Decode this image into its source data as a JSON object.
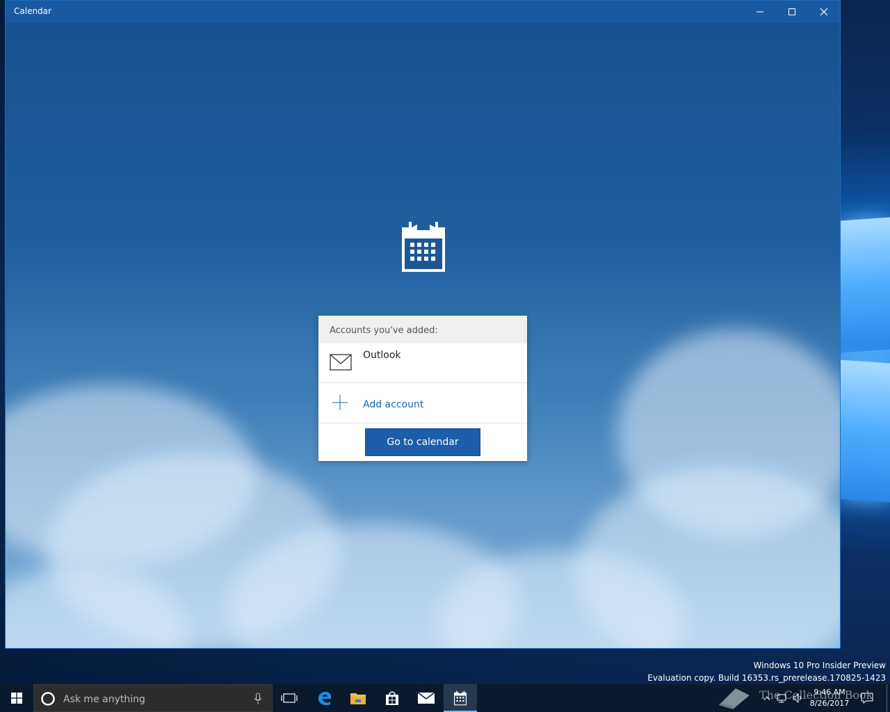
{
  "window": {
    "title": "Calendar",
    "minimize_icon": "minimize-icon",
    "maximize_icon": "maximize-icon",
    "close_icon": "close-icon"
  },
  "welcome": {
    "app_icon": "calendar-icon",
    "accounts_header": "Accounts you've added:",
    "accounts": [
      {
        "name": "Outlook",
        "icon": "mail-icon"
      }
    ],
    "add_account_label": "Add account",
    "add_account_icon": "plus-icon",
    "go_button_label": "Go to calendar"
  },
  "watermark": {
    "line1": "Windows 10 Pro Insider Preview",
    "line2": "Evaluation copy. Build 16353.rs_prerelease.170825-1423"
  },
  "taskbar": {
    "start_icon": "windows-start-icon",
    "search_placeholder": "Ask me anything",
    "cortana_icon": "cortana-circle-icon",
    "mic_icon": "microphone-icon",
    "pinned": [
      {
        "name": "Task View",
        "icon": "task-view-icon"
      },
      {
        "name": "Edge",
        "icon": "edge-icon"
      },
      {
        "name": "File Explorer",
        "icon": "folder-icon"
      },
      {
        "name": "Store",
        "icon": "store-icon"
      },
      {
        "name": "Mail",
        "icon": "mail-icon"
      },
      {
        "name": "Calendar",
        "icon": "calendar-icon",
        "active": true
      }
    ],
    "tray": {
      "overlay_text": "The Collection Book",
      "time": "9:46 AM",
      "date": "8/26/2017",
      "notification_icon": "action-center-icon"
    }
  },
  "colors": {
    "titlebar": "#1a5aa3",
    "accent": "#1c5ea8",
    "link": "#1a64b0",
    "taskbar": "#0a1a2c"
  }
}
